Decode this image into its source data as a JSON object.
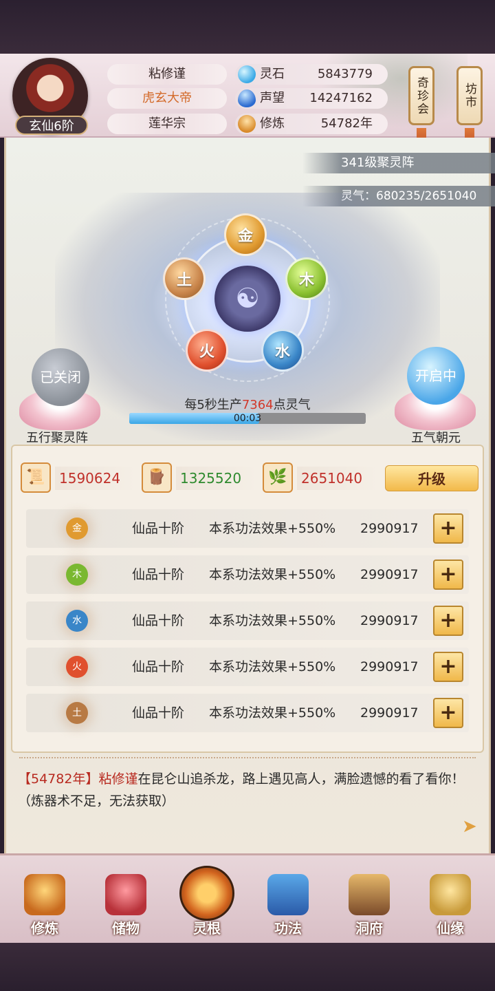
{
  "header": {
    "rank": "玄仙6阶",
    "name": "粘修谨",
    "title": "虎玄大帝",
    "sect": "莲华宗",
    "resources": [
      {
        "icon": "spirit-stone-icon",
        "label": "灵石",
        "value": "5843779"
      },
      {
        "icon": "reputation-icon",
        "label": "声望",
        "value": "14247162"
      },
      {
        "icon": "meditation-icon",
        "label": "修炼",
        "value": "54782年"
      }
    ],
    "side_buttons": [
      "奇珍会",
      "坊市"
    ]
  },
  "array": {
    "level_title": "341级聚灵阵",
    "qi_label": "灵气：680235/2651040",
    "elements": {
      "gold": "金",
      "wood": "木",
      "water": "水",
      "fire": "火",
      "earth": "土"
    },
    "left_toggle": {
      "state": "已关闭",
      "label": "五行聚灵阵"
    },
    "right_toggle": {
      "state": "开启中",
      "label": "五气朝元"
    },
    "rate_prefix": "每5秒生产",
    "rate_value": "7364",
    "rate_suffix": "点灵气",
    "progress_text": "00:03",
    "progress_fraction": 0.55
  },
  "upgrade": {
    "costs": [
      {
        "icon": "scroll-icon",
        "value": "1590624",
        "color": "#c0302a"
      },
      {
        "icon": "wood-plank-icon",
        "value": "1325520",
        "color": "#2e8a2e"
      },
      {
        "icon": "herb-icon",
        "value": "2651040",
        "color": "#c0302a"
      }
    ],
    "button": "升级"
  },
  "rows": [
    {
      "element": "金",
      "grade": "仙品十阶",
      "effect": "本系功法效果+550%",
      "cost": "2990917",
      "plus": "+"
    },
    {
      "element": "木",
      "grade": "仙品十阶",
      "effect": "本系功法效果+550%",
      "cost": "2990917",
      "plus": "+"
    },
    {
      "element": "水",
      "grade": "仙品十阶",
      "effect": "本系功法效果+550%",
      "cost": "2990917",
      "plus": "+"
    },
    {
      "element": "火",
      "grade": "仙品十阶",
      "effect": "本系功法效果+550%",
      "cost": "2990917",
      "plus": "+"
    },
    {
      "element": "土",
      "grade": "仙品十阶",
      "effect": "本系功法效果+550%",
      "cost": "2990917",
      "plus": "+"
    }
  ],
  "log": {
    "year": "【54782年】",
    "name": "粘修谨",
    "text": "在昆仑山追杀龙，路上遇见高人，满脸遗憾的看了看你！（炼器术不足，无法获取）"
  },
  "nav": [
    "修炼",
    "储物",
    "灵根",
    "功法",
    "洞府",
    "仙缘"
  ]
}
